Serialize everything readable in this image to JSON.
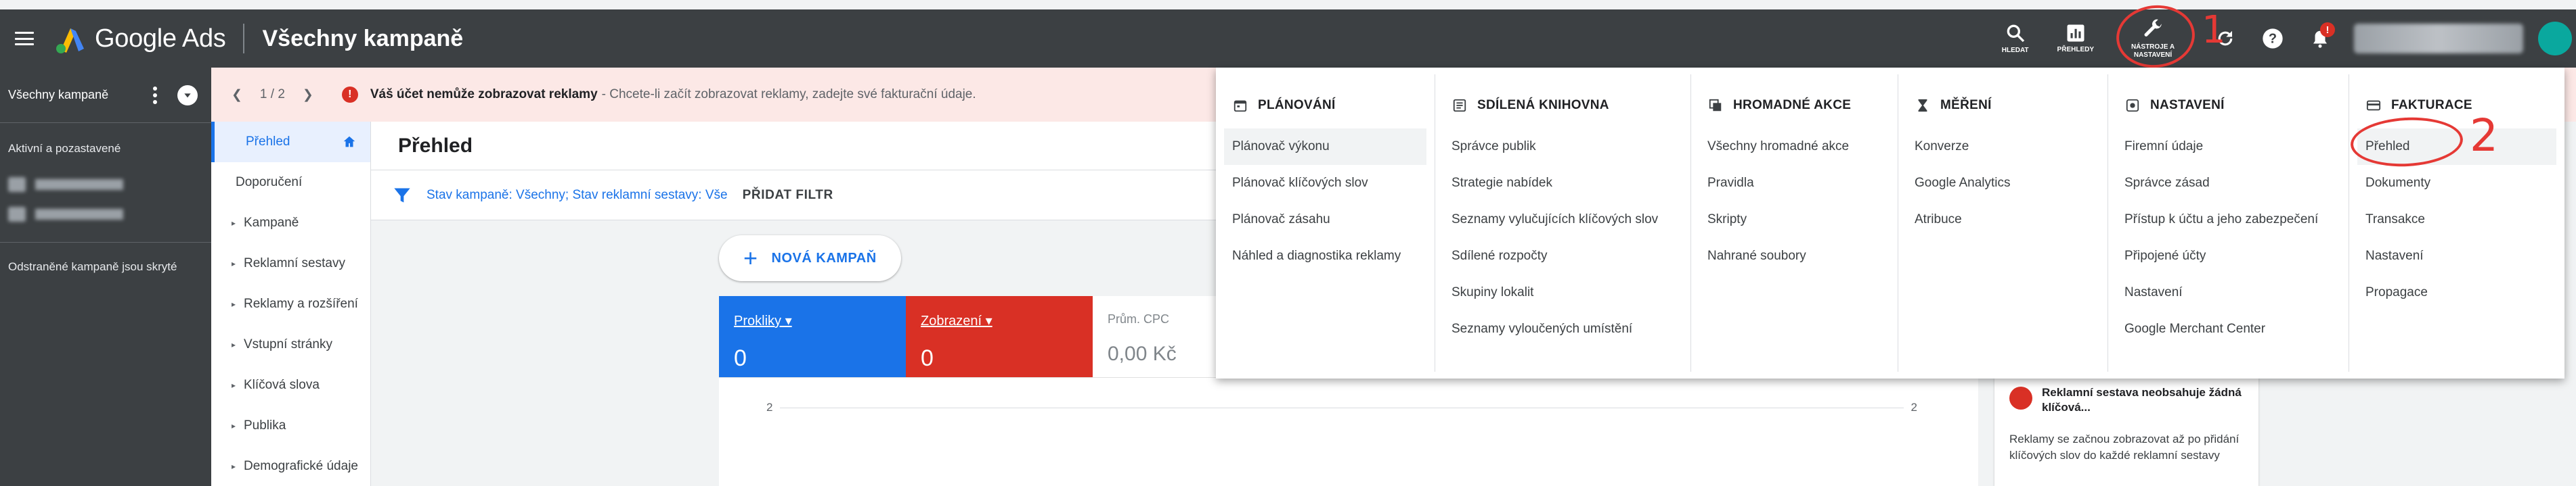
{
  "header": {
    "brand": "Google Ads",
    "title": "Všechny kampaně",
    "actions": {
      "search": "HLEDAT",
      "reports": "PŘEHLEDY",
      "tools": "NÁSTROJE A NASTAVENÍ"
    },
    "alert_badge": "!",
    "annotation_one": "1"
  },
  "leftnav": {
    "header": "Všechny kampaně",
    "subtitle": "Aktivní a pozastavené",
    "removed_note": "Odstraněné kampaně jsou skryté"
  },
  "notification": {
    "pager": "1 / 2",
    "error_icon": "!",
    "bold": "Váš účet nemůže zobrazovat reklamy",
    "message": "- Chcete-li začít zobrazovat reklamy, zadejte své fakturační údaje."
  },
  "secnav": {
    "items": [
      {
        "label": "Přehled",
        "active": true
      },
      {
        "label": "Doporučení"
      },
      {
        "label": "Kampaně"
      },
      {
        "label": "Reklamní sestavy"
      },
      {
        "label": "Reklamy a rozšíření"
      },
      {
        "label": "Vstupní stránky"
      },
      {
        "label": "Klíčová slova"
      },
      {
        "label": "Publika"
      },
      {
        "label": "Demografické údaje"
      }
    ]
  },
  "main": {
    "title": "Přehled",
    "filter": {
      "prefix": "Stav kampaně: ",
      "campaign_value": "Všechny",
      "middle": "; Stav reklamní sestavy: ",
      "adgroup_value": "Vše",
      "add_filter": "PŘIDAT FILTR"
    },
    "new_campaign": "NOVÁ KAMPAŇ",
    "metrics": [
      {
        "label": "Prokliky",
        "value": "0"
      },
      {
        "label": "Zobrazení",
        "value": "0"
      },
      {
        "label": "Prům. CPC",
        "value": "0,00 Kč"
      }
    ],
    "chart": {
      "y_left": "2",
      "y_right": "2"
    },
    "card": {
      "title": "Reklamní sestava neobsahuje žádná klíčová...",
      "text": "Reklamy se začnou zobrazovat až po přidání klíčových slov do každé reklamní sestavy"
    }
  },
  "tools_panel": {
    "columns": [
      {
        "heading": "PLÁNOVÁNÍ",
        "icon": "calendar-icon",
        "items": [
          "Plánovač výkonu",
          "Plánovač klíčových slov",
          "Plánovač zásahu",
          "Náhled a diagnostika reklamy"
        ]
      },
      {
        "heading": "SDÍLENÁ KNIHOVNA",
        "icon": "library-icon",
        "items": [
          "Správce publik",
          "Strategie nabídek",
          "Seznamy vylučujících klíčových slov",
          "Sdílené rozpočty",
          "Skupiny lokalit",
          "Seznamy vyloučených umístění"
        ]
      },
      {
        "heading": "HROMADNÉ AKCE",
        "icon": "copy-icon",
        "items": [
          "Všechny hromadné akce",
          "Pravidla",
          "Skripty",
          "Nahrané soubory"
        ]
      },
      {
        "heading": "MĚŘENÍ",
        "icon": "hourglass-icon",
        "items": [
          "Konverze",
          "Google Analytics",
          "Atribuce"
        ]
      },
      {
        "heading": "NASTAVENÍ",
        "icon": "settings-icon",
        "items": [
          "Firemní údaje",
          "Správce zásad",
          "Přístup k účtu a jeho zabezpečení",
          "Připojené účty",
          "Nastavení",
          "Google Merchant Center"
        ]
      },
      {
        "heading": "FAKTURACE",
        "icon": "card-icon",
        "items": [
          "Přehled",
          "Dokumenty",
          "Transakce",
          "Nastavení",
          "Propagace"
        ]
      }
    ],
    "annotation_two": "2"
  },
  "colors": {
    "header_bg": "#3c4043",
    "accent_blue": "#1a73e8",
    "accent_red": "#d93025",
    "annotation_red": "#e53935"
  }
}
